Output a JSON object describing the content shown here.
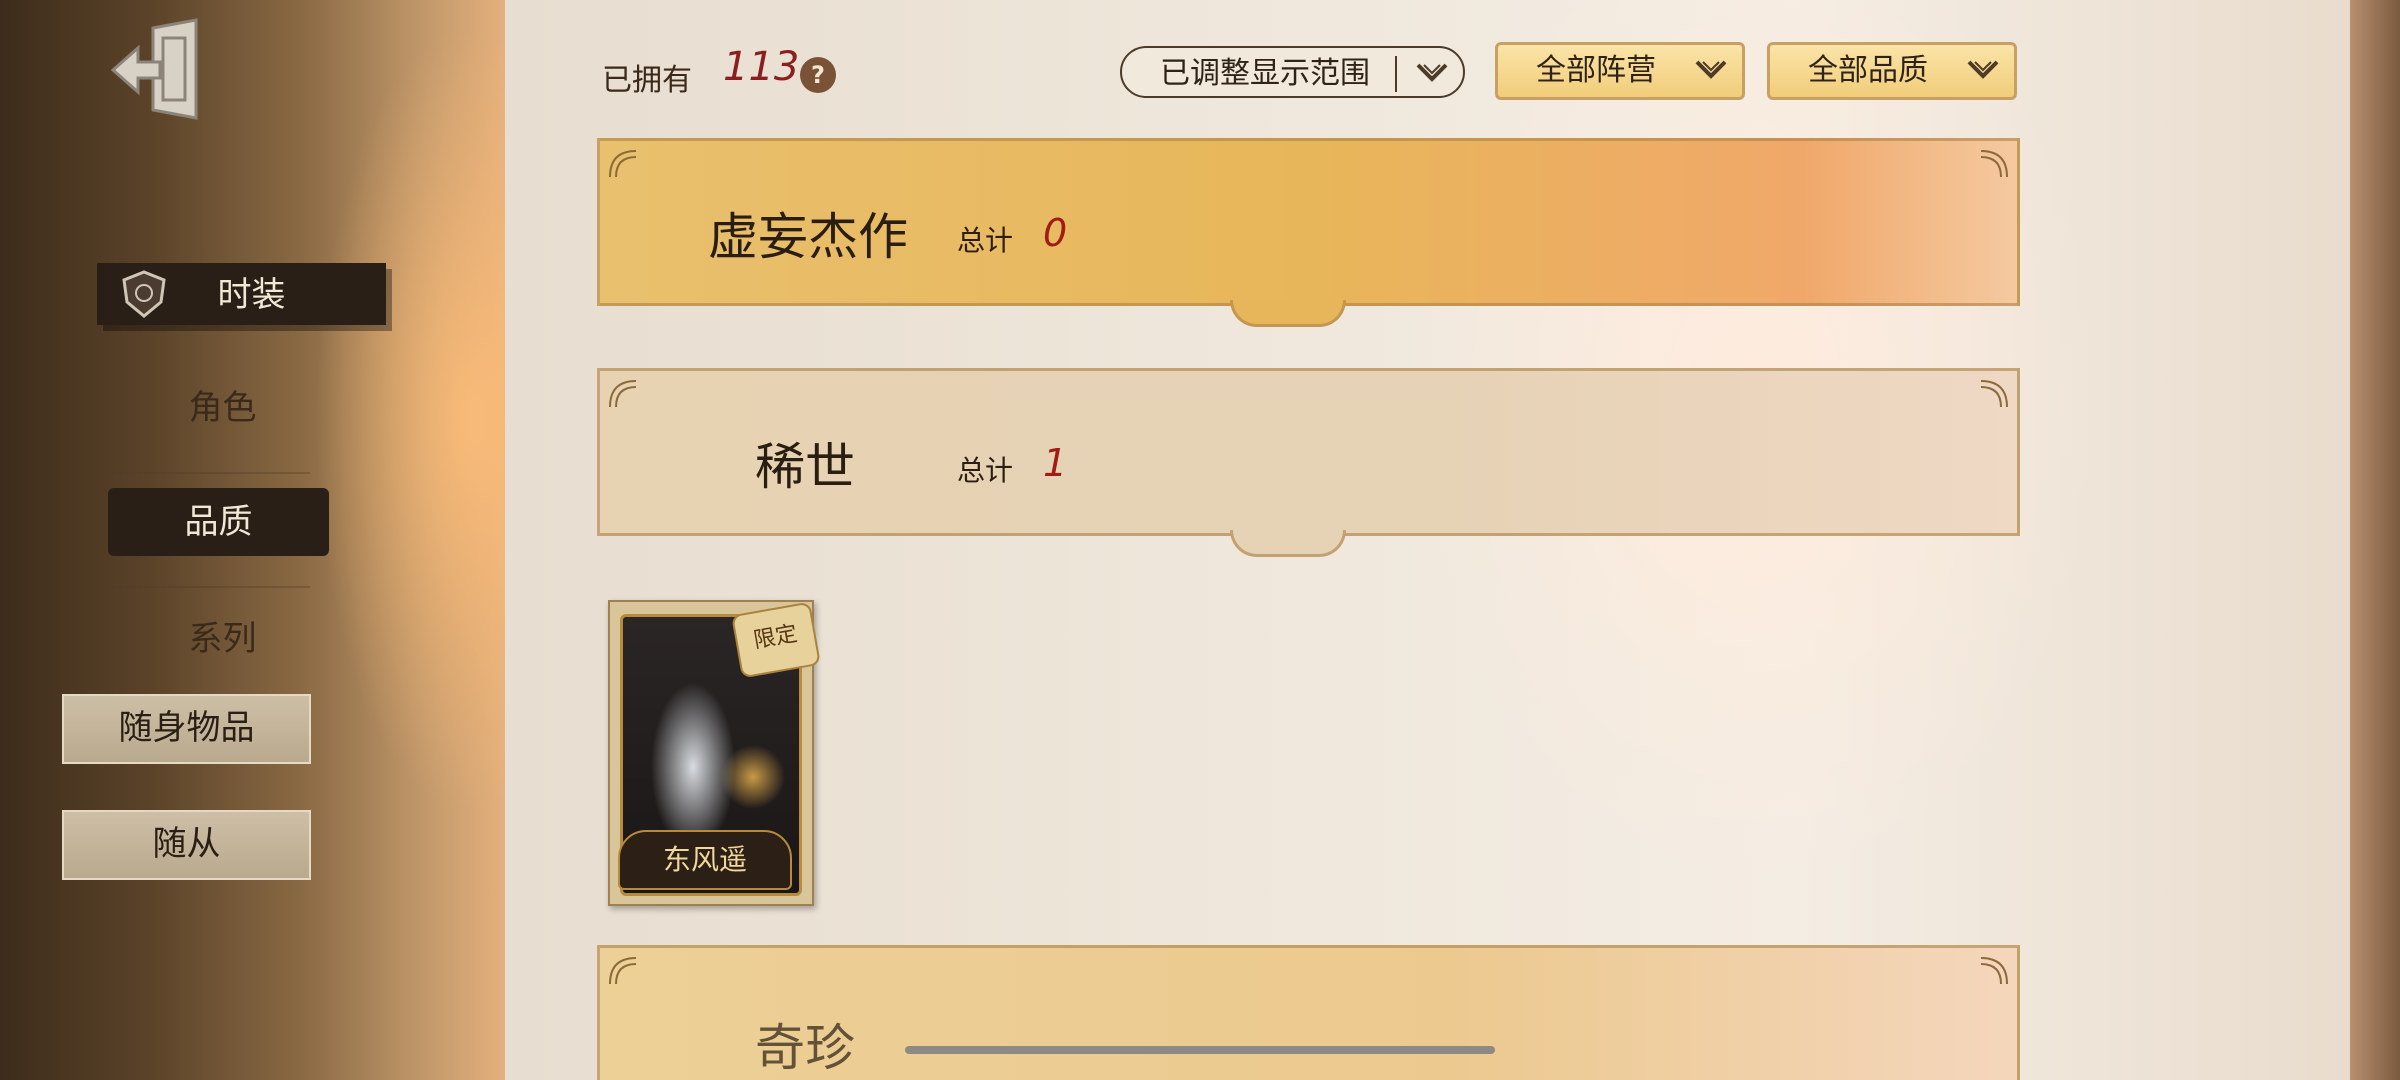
{
  "sidebar": {
    "items": [
      {
        "label": "时装",
        "icon": "shield-emblem-icon"
      },
      {
        "label": "角色"
      },
      {
        "label": "品质"
      },
      {
        "label": "系列"
      },
      {
        "label": "随身物品"
      },
      {
        "label": "随从"
      }
    ]
  },
  "header": {
    "owned_label": "已拥有",
    "owned_count": "113",
    "help_glyph": "?",
    "filters": [
      {
        "label": "已调整显示范围"
      },
      {
        "label": "全部阵营"
      },
      {
        "label": "全部品质"
      }
    ]
  },
  "sections": [
    {
      "title": "虚妄杰作",
      "total_label": "总计",
      "total_value": "0"
    },
    {
      "title": "稀世",
      "total_label": "总计",
      "total_value": "1"
    },
    {
      "title": "奇珍"
    }
  ],
  "cards": [
    {
      "name": "东风遥",
      "tag": "限定"
    }
  ],
  "colors": {
    "count_red": "#8a1f1f",
    "total_red": "#a11c14",
    "sidebar_selected_bg": "#2a1f16",
    "banner_gold": "#e8b65a"
  }
}
